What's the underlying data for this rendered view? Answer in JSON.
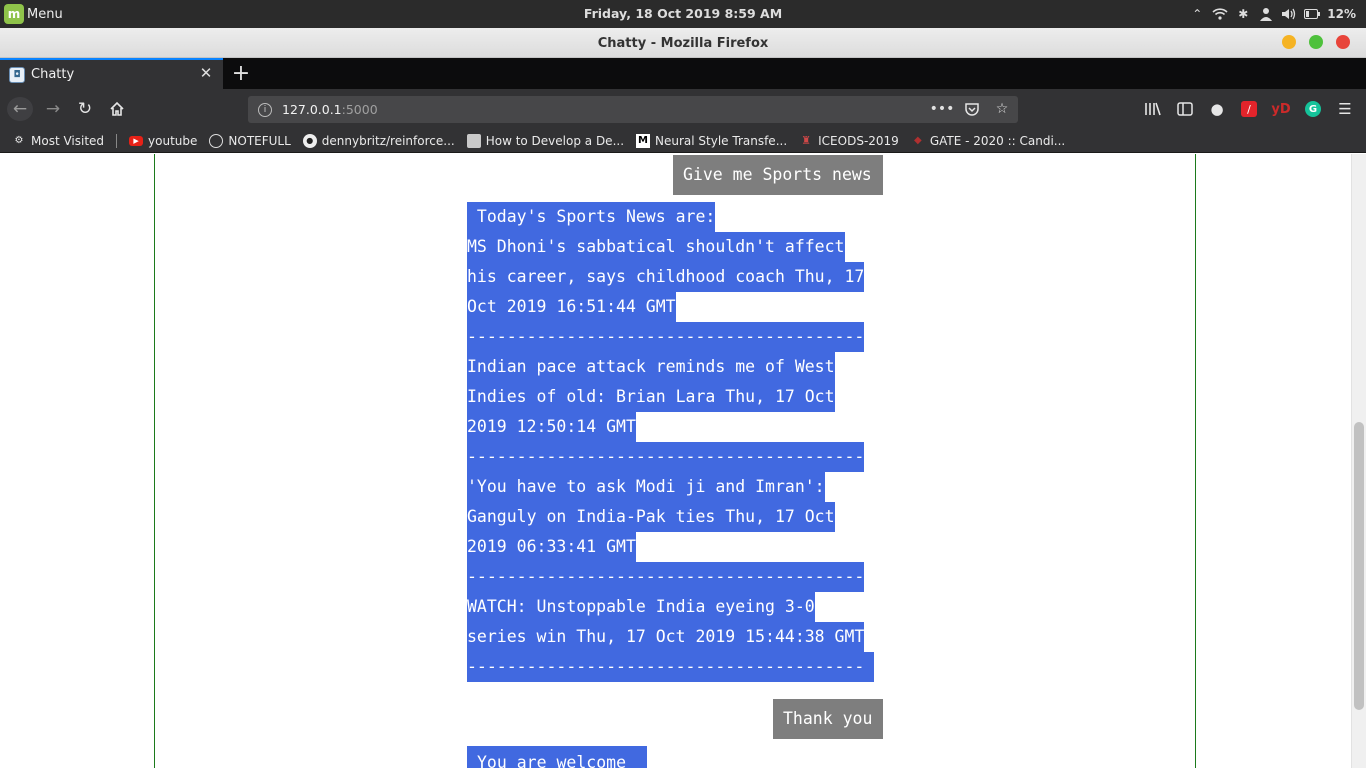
{
  "os": {
    "menu_label": "Menu",
    "clock": "Friday, 18 Oct 2019  8:59 AM",
    "battery": "12%"
  },
  "window": {
    "title": "Chatty - Mozilla Firefox"
  },
  "tabs": [
    {
      "title": "Chatty"
    }
  ],
  "navbar": {
    "url_host": "127.0.0.1",
    "url_port": ":5000",
    "more_label": "•••",
    "yd_label": "yD",
    "grammarly_label": "G"
  },
  "bookmarks": [
    {
      "label": "Most Visited",
      "icon": "gear-icon"
    },
    {
      "label": "youtube",
      "icon": "youtube-icon"
    },
    {
      "label": "NOTEFULL",
      "icon": "globe-icon"
    },
    {
      "label": "dennybritz/reinforce...",
      "icon": "github-icon"
    },
    {
      "label": "How to Develop a De...",
      "icon": "document-icon"
    },
    {
      "label": "Neural Style Transfe...",
      "icon": "medium-icon"
    },
    {
      "label": "ICEODS-2019",
      "icon": "iceods-icon"
    },
    {
      "label": "GATE - 2020 :: Candi...",
      "icon": "gate-icon"
    }
  ],
  "chat": {
    "user_messages": [
      "Give me Sports news",
      "Thank you"
    ],
    "bot_response_lines": [
      " Today's Sports News are:",
      "MS Dhoni's sabbatical shouldn't affect",
      "his career, says childhood coach Thu, 17",
      "Oct 2019 16:51:44 GMT",
      "----------------------------------------",
      "Indian pace attack reminds me of West",
      "Indies of old: Brian Lara Thu, 17 Oct",
      "2019 12:50:14 GMT",
      "----------------------------------------",
      "'You have to ask Modi ji and Imran':",
      "Ganguly on India-Pak ties Thu, 17 Oct",
      "2019 06:33:41 GMT",
      "----------------------------------------",
      "WATCH: Unstoppable India eyeing 3-0",
      "series win Thu, 17 Oct 2019 15:44:38 GMT",
      "----------------------------------------"
    ],
    "bot_welcome": "You are welcome"
  },
  "colors": {
    "bot_bubble": "#4169e0",
    "user_bubble": "#7e7e7e",
    "frame_border": "#1c7a1c"
  }
}
